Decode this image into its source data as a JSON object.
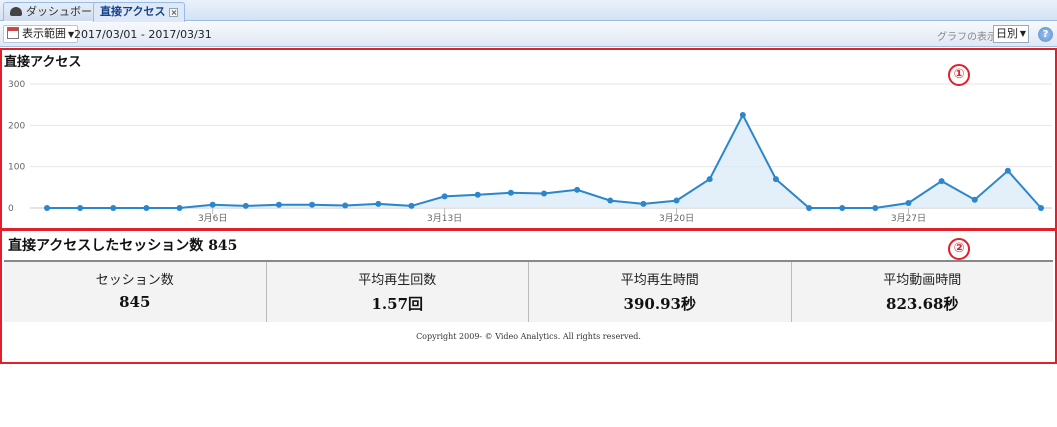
{
  "tabs": [
    {
      "label": "ダッシュボード",
      "icon": "dashboard-icon",
      "active": false
    },
    {
      "label": "直接アクセス",
      "icon": "close-icon",
      "active": true
    }
  ],
  "toolbar": {
    "range_button": "表示範囲",
    "range_text": "2017/03/01 - 2017/03/31",
    "graph_label": "グラフの表示",
    "graph_select": "日別",
    "help": "?"
  },
  "markers": [
    "①",
    "②"
  ],
  "chart_title": "直接アクセス",
  "chart_data": {
    "type": "area",
    "title": "直接アクセス",
    "xlabel": "",
    "ylabel": "",
    "ylim": [
      0,
      300
    ],
    "yticks": [
      0,
      100,
      200,
      300
    ],
    "x": [
      1,
      2,
      3,
      4,
      5,
      6,
      7,
      8,
      9,
      10,
      11,
      12,
      13,
      14,
      15,
      16,
      17,
      18,
      19,
      20,
      21,
      22,
      23,
      24,
      25,
      26,
      27,
      28,
      29,
      30,
      31
    ],
    "xtick_labels": [
      {
        "day": 6,
        "label": "3月6日"
      },
      {
        "day": 13,
        "label": "3月13日"
      },
      {
        "day": 20,
        "label": "3月20日"
      },
      {
        "day": 27,
        "label": "3月27日"
      }
    ],
    "series": [
      {
        "values": [
          0,
          0,
          0,
          0,
          0,
          8,
          5,
          8,
          8,
          6,
          10,
          5,
          28,
          32,
          37,
          35,
          44,
          18,
          10,
          18,
          70,
          225,
          70,
          0,
          0,
          0,
          12,
          65,
          20,
          90,
          0
        ]
      }
    ],
    "colors": {
      "line": "#2b86cc",
      "fill": "#dcebf8"
    },
    "grid": true
  },
  "session": {
    "title": "直接アクセスしたセッション数",
    "count": "845"
  },
  "stats": [
    {
      "label": "セッション数",
      "value": "845"
    },
    {
      "label": "平均再生回数",
      "value": "1.57回"
    },
    {
      "label": "平均再生時間",
      "value": "390.93秒"
    },
    {
      "label": "平均動画時間",
      "value": "823.68秒"
    }
  ],
  "copyright": "Copyright 2009- © Video Analytics. All rights reserved."
}
